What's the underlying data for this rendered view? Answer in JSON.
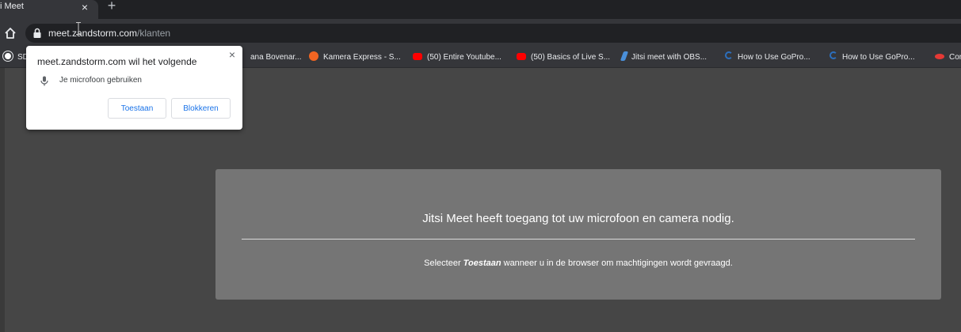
{
  "browser": {
    "tab": {
      "title": "i Meet",
      "close_glyph": "×",
      "new_tab_glyph": "+"
    },
    "url": {
      "host": "meet.zandstorm.com",
      "path": "/klanten"
    },
    "bookmarks": [
      {
        "label": "SD",
        "icon": "globe-icon"
      },
      {
        "label": "ana Bovenar...",
        "icon": ""
      },
      {
        "label": "Kamera Express - S...",
        "icon": "kamera-express-icon"
      },
      {
        "label": "(50) Entire Youtube...",
        "icon": "youtube-icon"
      },
      {
        "label": "(50) Basics of Live S...",
        "icon": "youtube-icon"
      },
      {
        "label": "Jitsi meet with OBS...",
        "icon": "jitsi-icon"
      },
      {
        "label": "How to Use GoPro...",
        "icon": "c-icon"
      },
      {
        "label": "How to Use GoPro...",
        "icon": "c-icon"
      },
      {
        "label": "Cor",
        "icon": "red-icon"
      }
    ]
  },
  "permission_dialog": {
    "title": "meet.zandstorm.com wil het volgende",
    "close_glyph": "×",
    "item": "Je microfoon gebruiken",
    "allow_label": "Toestaan",
    "block_label": "Blokkeren"
  },
  "overlay": {
    "title": "Jitsi Meet heeft toegang tot uw microfoon en camera nodig.",
    "text_before": "Selecteer ",
    "text_bold": "Toestaan",
    "text_after": " wanneer u in de browser om machtigingen wordt gevraagd."
  },
  "colors": {
    "tab_strip": "#202124",
    "toolbar": "#35363a",
    "page_background": "#464646",
    "overlay_card": "#757575",
    "dialog_button_text": "#1a73e8",
    "youtube_red": "#ff0000"
  }
}
